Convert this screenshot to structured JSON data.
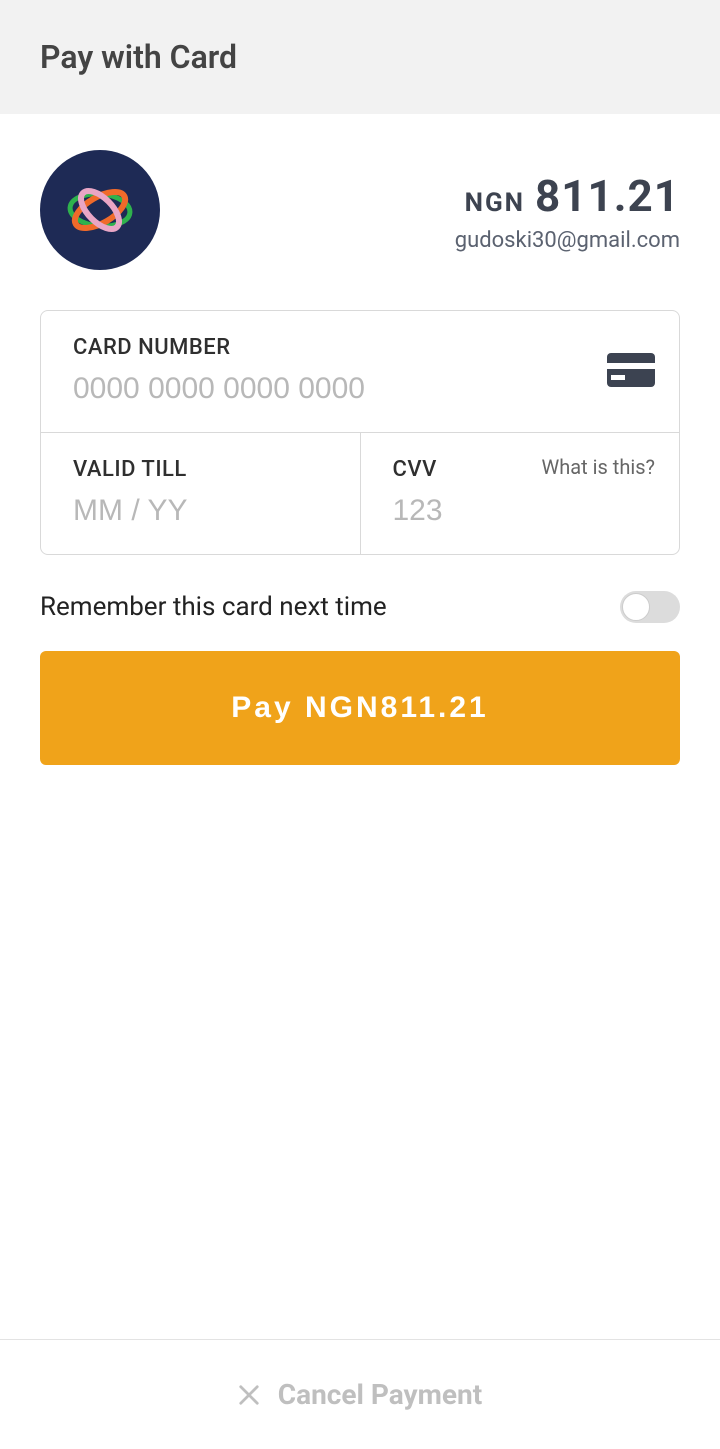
{
  "header": {
    "title": "Pay with Card"
  },
  "summary": {
    "currency": "NGN",
    "amount": "811.21",
    "email": "gudoski30@gmail.com"
  },
  "form": {
    "card_number": {
      "label": "CARD NUMBER",
      "placeholder": "0000 0000 0000 0000",
      "value": ""
    },
    "valid_till": {
      "label": "VALID TILL",
      "placeholder": "MM / YY",
      "value": ""
    },
    "cvv": {
      "label": "CVV",
      "placeholder": "123",
      "value": "",
      "hint": "What is this?"
    }
  },
  "remember": {
    "label": "Remember this card next time",
    "checked": false
  },
  "pay_button_label": "Pay NGN811.21",
  "footer": {
    "cancel_label": "Cancel Payment"
  }
}
